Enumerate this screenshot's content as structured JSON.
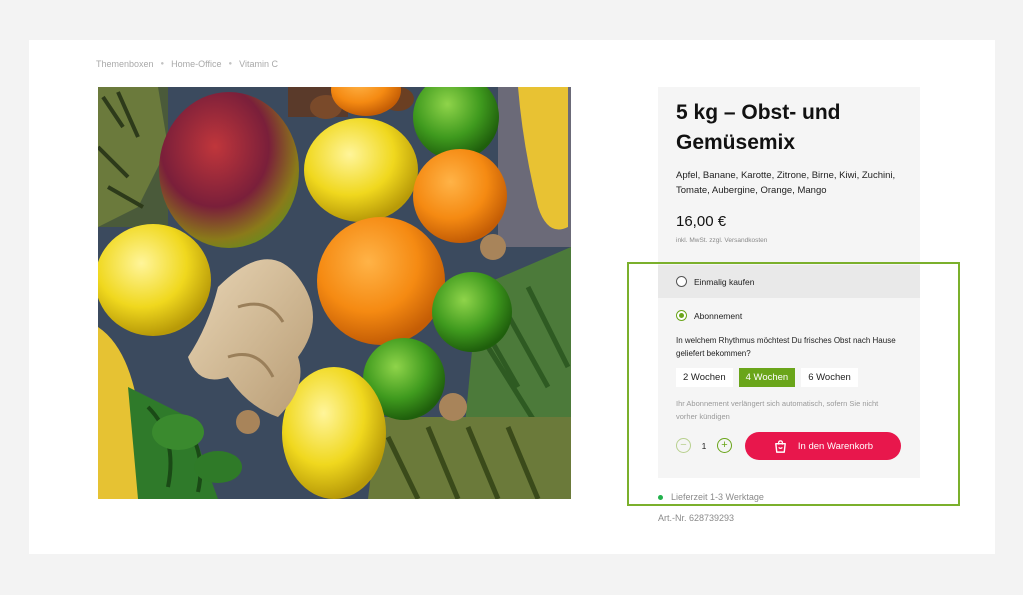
{
  "breadcrumb": [
    "Themenboxen",
    "Home-Office",
    "Vitamin C"
  ],
  "product": {
    "title": "5 kg – Obst- und Gemüsemix",
    "description": "Apfel, Banane, Karotte, Zitrone, Birne, Kiwi, Zuchini, Tomate, Aubergine, Orange, Mango",
    "price": "16,00 €",
    "tax_note": "inkl. MwSt. zzgl. Versandkosten"
  },
  "purchase": {
    "once_label": "Einmalig kaufen",
    "subscription_label": "Abonnement",
    "selected": "subscription",
    "question": "In welchem Rhythmus möchtest Du frisches Obst nach Hause geliefert bekommen?",
    "rhythm_options": [
      "2 Wochen",
      "4 Wochen",
      "6 Wochen"
    ],
    "rhythm_selected": "4 Wochen",
    "note": "Ihr Abonnement verlängert sich automatisch, sofern Sie nicht vorher kündigen",
    "quantity": "1",
    "minus": "−",
    "plus": "+",
    "cart_label": "In den Warenkorb"
  },
  "delivery": "Lieferzeit 1-3 Werktage",
  "article_number": "Art.-Nr. 628739293",
  "colors": {
    "accent_green": "#6aa51a",
    "cart_red": "#e8174c",
    "highlight_border": "#7bb02c",
    "status_dot": "#22b14c"
  },
  "icons": [
    "bag-icon",
    "minus-icon",
    "plus-icon",
    "status-dot"
  ]
}
